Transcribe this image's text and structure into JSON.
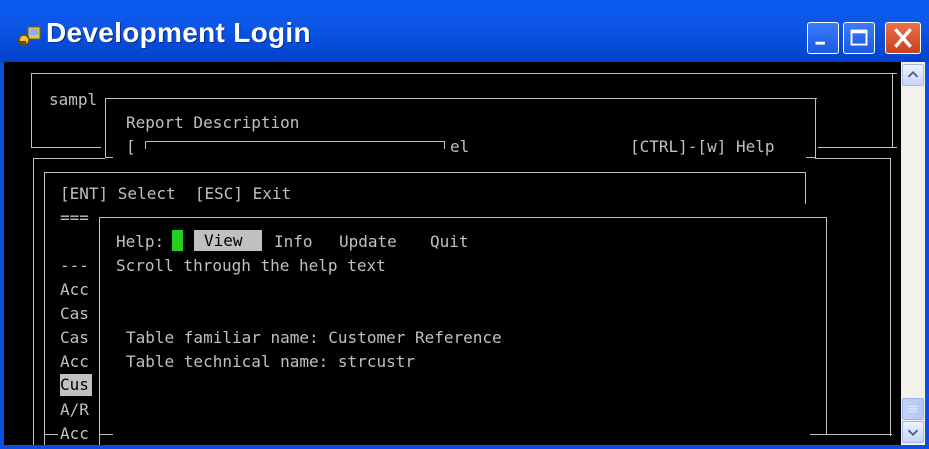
{
  "window": {
    "title": "Development Login",
    "buttons": {
      "minimize": "minimize",
      "maximize": "maximize",
      "close": "close"
    }
  },
  "terminal": {
    "outer_label": "sampl",
    "report_description": "Report Description",
    "bracket_open": "[",
    "field_suffix": "el",
    "ctrl_help": "[CTRL]-[w] Help",
    "select_exit": "[ENT] Select  [ESC] Exit",
    "equals_marker": "===",
    "dash_marker": "---",
    "list_items": [
      "Acc",
      "Cas",
      "Cas",
      "Acc",
      "Cus",
      "A/R",
      "Acc"
    ],
    "selected_list_index": 4,
    "help": {
      "label": "Help:",
      "menu": [
        "View",
        "Info",
        "Update",
        "Quit"
      ],
      "selected_menu_index": 0,
      "description": "Scroll through the help text",
      "familiar_name": "Table familiar name: Customer Reference",
      "technical_name": "Table technical name: strcustr"
    }
  },
  "colors": {
    "title_bar": "#0a5cf0",
    "terminal_background": "#000000",
    "terminal_text": "#c0c0c0",
    "cursor": "#22d022",
    "close_button": "#d9532c"
  },
  "icons": {
    "app": "key-icon",
    "minimize": "minimize-icon",
    "maximize": "maximize-icon",
    "close": "close-icon",
    "scroll_up": "arrow-up-icon",
    "scroll_down": "arrow-down-icon"
  }
}
